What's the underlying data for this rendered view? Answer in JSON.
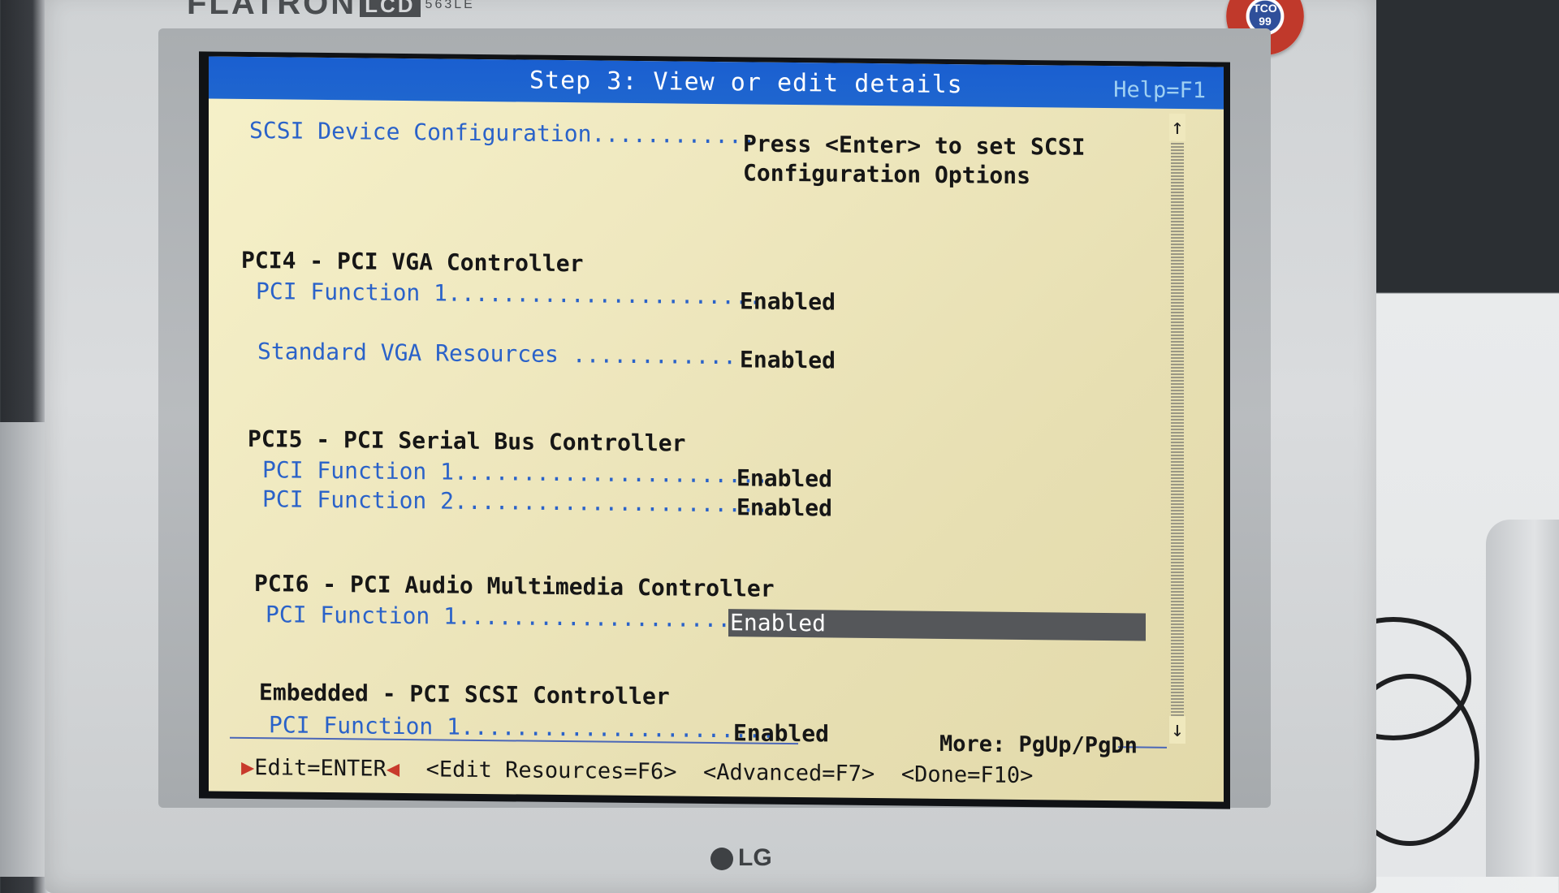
{
  "monitor": {
    "brand": "FLATRON",
    "lcd": "LCD",
    "model": "563LE",
    "tco_badge": "TCO 99",
    "logo": "LG"
  },
  "titlebar": {
    "title": "Step 3:  View or edit details",
    "help": "Help=F1"
  },
  "entries": {
    "scsi": {
      "label": "SCSI Device Configuration............",
      "value_line1": "Press <Enter> to set SCSI",
      "value_line2": "Configuration Options"
    },
    "pci4": {
      "heading": "PCI4 - PCI VGA Controller",
      "func1_label": "PCI Function 1.......................",
      "func1_value": "Enabled",
      "vga_label": "Standard VGA Resources ..............",
      "vga_value": "Enabled"
    },
    "pci5": {
      "heading": "PCI5 - PCI Serial Bus Controller",
      "func1_label": "PCI Function 1.......................",
      "func1_value": "Enabled",
      "func2_label": "PCI Function 2.......................",
      "func2_value": "Enabled"
    },
    "pci6": {
      "heading": "PCI6 - PCI Audio Multimedia Controller",
      "func1_label": "PCI Function 1.......................",
      "func1_value": "Enabled"
    },
    "embedded": {
      "heading": "Embedded - PCI SCSI Controller",
      "func1_label": "PCI Function 1.......................",
      "func1_value": "Enabled"
    }
  },
  "more": "More: PgUp/PgDn",
  "footer": {
    "edit": "Edit=ENTER",
    "edit_resources": "<Edit Resources=F6>",
    "advanced": "<Advanced=F7>",
    "done": "<Done=F10>"
  },
  "scroll": {
    "up_arrow": "↑",
    "down_arrow": "↓"
  },
  "colors": {
    "titlebar_blue": "#1f66cf",
    "label_blue": "#2a62c9",
    "background": "#efe8bf",
    "selection": "#55575a"
  }
}
